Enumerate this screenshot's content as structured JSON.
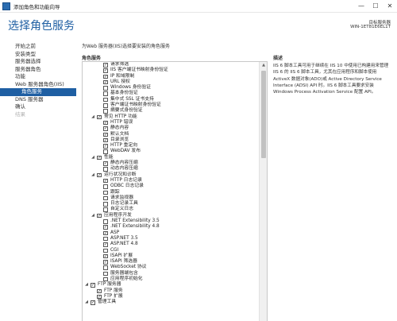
{
  "window": {
    "title": "添加角色和功能向导",
    "minimize": "—",
    "maximize": "☐",
    "close": "✕"
  },
  "page": {
    "title": "选择角色服务",
    "server_label": "目标服务器",
    "server_name": "WIN-1ET81E6EL1T"
  },
  "sidebar": {
    "items": [
      {
        "label": "开始之前",
        "state": "normal"
      },
      {
        "label": "安装类型",
        "state": "normal"
      },
      {
        "label": "服务器选择",
        "state": "normal"
      },
      {
        "label": "服务器角色",
        "state": "normal"
      },
      {
        "label": "功能",
        "state": "normal"
      },
      {
        "label": "Web 服务器角色(IIS)",
        "state": "normal"
      },
      {
        "label": "角色服务",
        "state": "active"
      },
      {
        "label": "DNS 服务器",
        "state": "normal"
      },
      {
        "label": "确认",
        "state": "normal"
      },
      {
        "label": "结果",
        "state": "disabled"
      }
    ]
  },
  "content": {
    "intro": "为Web 服务器(IIS)选择要安装的角色服务",
    "roles_label": "角色服务",
    "description_label": "描述",
    "description_text": "IIS 6 脚本工具可用于继续在 IIS 10 中使用已构建用来管理 IIS 6 的 IIS 6 脚本工具，尤其在应用程序和脚本使用 ActiveX 数据对象(ADO)或 Active Directory Service Interface (ADSI) API 时。IIS 6 脚本工具要求安装 Windows Process Activation Service 配置 API。"
  },
  "tree": [
    {
      "label": "请求筛选",
      "level": 3,
      "checked": true
    },
    {
      "label": "IIS 客户端证书映射身份验证",
      "level": 3,
      "checked": true
    },
    {
      "label": "IP 和域限制",
      "level": 3,
      "checked": true
    },
    {
      "label": "URL 授权",
      "level": 3,
      "checked": true
    },
    {
      "label": "Windows 身份验证",
      "level": 3,
      "checked": false
    },
    {
      "label": "基本身份验证",
      "level": 3,
      "checked": false
    },
    {
      "label": "集中式 SSL 证书支持",
      "level": 3,
      "checked": false
    },
    {
      "label": "客户端证书映射身份验证",
      "level": 3,
      "checked": false
    },
    {
      "label": "摘要式身份验证",
      "level": 3,
      "checked": false
    },
    {
      "label": "常见 HTTP 功能",
      "level": 2,
      "checked": true,
      "expander": "◢"
    },
    {
      "label": "HTTP 错误",
      "level": 3,
      "checked": true
    },
    {
      "label": "静态内容",
      "level": 3,
      "checked": true
    },
    {
      "label": "默认文档",
      "level": 3,
      "checked": true
    },
    {
      "label": "目录浏览",
      "level": 3,
      "checked": true
    },
    {
      "label": "HTTP 重定向",
      "level": 3,
      "checked": true
    },
    {
      "label": "WebDAV 发布",
      "level": 3,
      "checked": false
    },
    {
      "label": "性能",
      "level": 2,
      "checked": true,
      "expander": "◢"
    },
    {
      "label": "静态内容压缩",
      "level": 3,
      "checked": true
    },
    {
      "label": "动态内容压缩",
      "level": 3,
      "checked": false
    },
    {
      "label": "运行状况和诊断",
      "level": 2,
      "checked": true,
      "expander": "◢"
    },
    {
      "label": "HTTP 日志记录",
      "level": 3,
      "checked": true
    },
    {
      "label": "ODBC 日志记录",
      "level": 3,
      "checked": false
    },
    {
      "label": "跟踪",
      "level": 3,
      "checked": false
    },
    {
      "label": "请求监视器",
      "level": 3,
      "checked": false
    },
    {
      "label": "日志记录工具",
      "level": 3,
      "checked": false
    },
    {
      "label": "自定义日志",
      "level": 3,
      "checked": false
    },
    {
      "label": "应用程序开发",
      "level": 2,
      "checked": true,
      "expander": "◢"
    },
    {
      "label": ".NET Extensibility 3.5",
      "level": 3,
      "checked": false
    },
    {
      "label": ".NET Extensibility 4.8",
      "level": 3,
      "checked": true
    },
    {
      "label": "ASP",
      "level": 3,
      "checked": true
    },
    {
      "label": "ASP.NET 3.5",
      "level": 3,
      "checked": false
    },
    {
      "label": "ASP.NET 4.8",
      "level": 3,
      "checked": true
    },
    {
      "label": "CGI",
      "level": 3,
      "checked": false
    },
    {
      "label": "ISAPI 扩展",
      "level": 3,
      "checked": true
    },
    {
      "label": "ISAPI 筛选器",
      "level": 3,
      "checked": true
    },
    {
      "label": "WebSocket 协议",
      "level": 3,
      "checked": false
    },
    {
      "label": "服务器端包含",
      "level": 3,
      "checked": false
    },
    {
      "label": "应用程序初始化",
      "level": 3,
      "checked": false
    },
    {
      "label": "FTP 服务器",
      "level": 1,
      "checked": true,
      "expander": "◢"
    },
    {
      "label": "FTP 服务",
      "level": 2,
      "checked": true
    },
    {
      "label": "FTP 扩展",
      "level": 2,
      "checked": true
    },
    {
      "label": "管理工具",
      "level": 1,
      "checked": true,
      "expander": "◢"
    }
  ],
  "scrollbar": {
    "up": "▲"
  }
}
